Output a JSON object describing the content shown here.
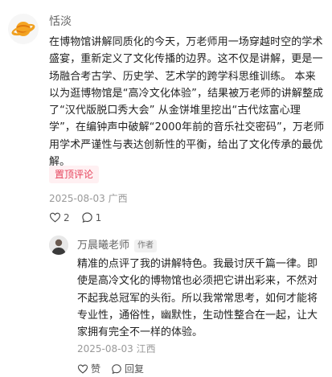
{
  "comment": {
    "author": "恬淡",
    "avatar_icon": "planet-avatar-icon",
    "text": "在博物馆讲解同质化的今天，万老师用一场穿越时空的学术盛宴，重新定义了文化传播的边界。这不仅是讲解，更是一场融合考古学、历史学、艺术学的跨学科思维训练。 本来以为逛博物馆是“高冷文化体验”，结果被万老师的讲解整成了“汉代版脱口秀大会” 从金饼堆里挖出“古代炫富心理学”，在编钟声中破解“2000年前的音乐社交密码”，万老师用学术严谨性与表达创新性的平衡，给出了文化传承的最优解。",
    "pin_label": "置顶评论",
    "date": "2025-08-03",
    "location": "广西",
    "like_count": "2",
    "reply_count": "1"
  },
  "reply": {
    "author": "万晨曦老师",
    "author_tag": "作者",
    "text": "精准的点评了我的讲解特色。我最讨厌千篇一律。即使是高冷文化的博物馆也必须把它讲出彩来，不然对不起我总冠军的头衔。所以我常常思考，如何才能将专业性，通俗性，幽默性，生动性整合在一起，让大家拥有完全不一样的体验。",
    "date": "2025-08-03",
    "location": "江西",
    "like_label": "赞",
    "reply_label": "回复"
  },
  "colors": {
    "pin_text": "#e6435c",
    "pin_bg": "#fff0f2",
    "meta": "#999999"
  }
}
